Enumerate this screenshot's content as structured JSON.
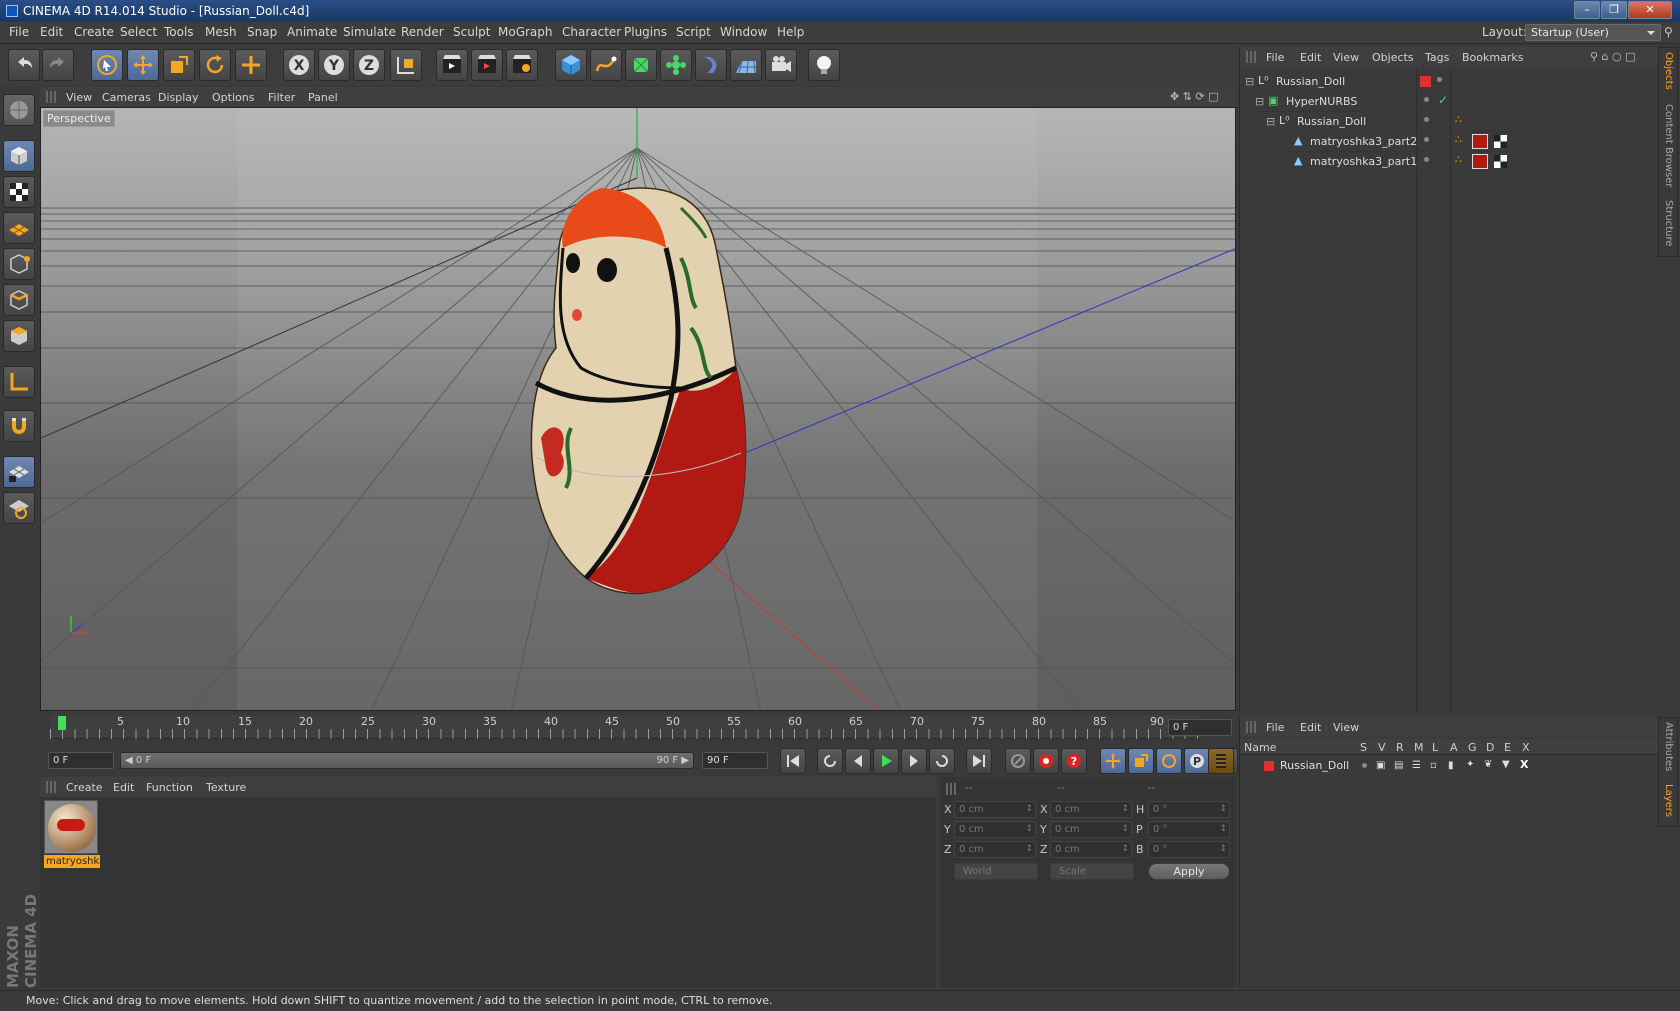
{
  "window": {
    "title": "CINEMA 4D R14.014 Studio - [Russian_Doll.c4d]",
    "controls": [
      "–",
      "❐",
      "✕"
    ]
  },
  "menubar": {
    "items": [
      "File",
      "Edit",
      "Create",
      "Select",
      "Tools",
      "Mesh",
      "Snap",
      "Animate",
      "Simulate",
      "Render",
      "Sculpt",
      "MoGraph",
      "Character",
      "Plugins",
      "Script",
      "Window",
      "Help"
    ],
    "layout_label": "Layout:",
    "layout_value": "Startup (User)"
  },
  "viewport": {
    "menu": [
      "View",
      "Cameras",
      "Display",
      "Options",
      "Filter",
      "Panel"
    ],
    "label": "Perspective"
  },
  "objects": {
    "menu": [
      "File",
      "Edit",
      "View",
      "Objects",
      "Tags",
      "Bookmarks"
    ],
    "rows": [
      "Russian_Doll",
      "HyperNURBS",
      "Russian_Doll",
      "matryoshka3_part2",
      "matryoshka3_part1"
    ]
  },
  "side_tabs": [
    "Objects",
    "Content Browser",
    "Structure"
  ],
  "side_tabs_lower": [
    "Attributes",
    "Layers"
  ],
  "timeline": {
    "ticks": [
      "0",
      "5",
      "10",
      "15",
      "20",
      "25",
      "30",
      "35",
      "40",
      "45",
      "50",
      "55",
      "60",
      "65",
      "70",
      "75",
      "80",
      "85",
      "90"
    ],
    "frame_field": "0 F",
    "start_field": "0 F",
    "range_start": "0 F",
    "range_end": "90 F",
    "end_field": "90 F",
    "current_fraction": 0
  },
  "materials": {
    "menu": [
      "Create",
      "Edit",
      "Function",
      "Texture"
    ],
    "items": [
      "matryoshka"
    ]
  },
  "coordinates": {
    "headers": [
      "--",
      "--",
      "--"
    ],
    "rows": [
      {
        "a": "X",
        "av": "0 cm",
        "b": "X",
        "bv": "0 cm",
        "c": "H",
        "cv": "0 °"
      },
      {
        "a": "Y",
        "av": "0 cm",
        "b": "Y",
        "bv": "0 cm",
        "c": "P",
        "cv": "0 °"
      },
      {
        "a": "Z",
        "av": "0 cm",
        "b": "Z",
        "bv": "0 cm",
        "c": "B",
        "cv": "0 °"
      }
    ],
    "mode": "World",
    "size_mode": "Scale",
    "apply": "Apply"
  },
  "layers": {
    "menu": [
      "File",
      "Edit",
      "View"
    ],
    "name_header": "Name",
    "columns": [
      "S",
      "V",
      "R",
      "M",
      "L",
      "A",
      "G",
      "D",
      "E",
      "X"
    ],
    "rows": [
      "Russian_Doll"
    ]
  },
  "brand": "MAXON CINEMA 4D",
  "status": "Move: Click and drag to move elements. Hold down SHIFT to quantize movement / add to the selection in point mode, CTRL to remove.",
  "colors": {
    "accent": "#f5a623",
    "selection": "#5e7bab",
    "layer": "#e03030"
  }
}
